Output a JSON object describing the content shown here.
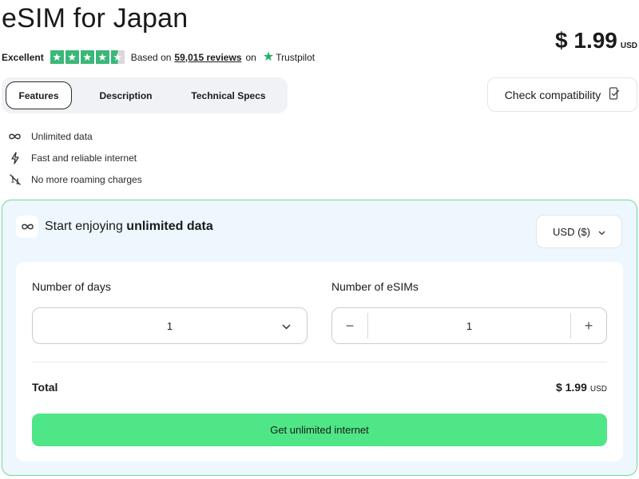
{
  "product": {
    "title": "eSIM for Japan",
    "price": "$ 1.99",
    "currency": "USD"
  },
  "rating": {
    "label": "Excellent",
    "stars": 4.5,
    "based_on": "Based on",
    "reviews": "59,015 reviews",
    "on": "on",
    "provider": "Trustpilot",
    "star_color": "#3bb779"
  },
  "tabs": [
    {
      "label": "Features",
      "active": true
    },
    {
      "label": "Description",
      "active": false
    },
    {
      "label": "Technical Specs",
      "active": false
    }
  ],
  "compatibility": {
    "label": "Check compatibility",
    "icon": "phone-check-icon"
  },
  "features": [
    {
      "icon": "infinity-icon",
      "label": "Unlimited data"
    },
    {
      "icon": "lightning-icon",
      "label": "Fast and reliable internet"
    },
    {
      "icon": "no-roaming-icon",
      "label": "No more roaming charges"
    }
  ],
  "panel": {
    "title_prefix": "Start enjoying",
    "title_bold": "unlimited data",
    "currency_select": "USD ($)",
    "days_label": "Number of days",
    "days_value": "1",
    "esims_label": "Number of eSIMs",
    "esims_value": "1",
    "minus": "−",
    "plus": "+",
    "total_label": "Total",
    "total_amount": "$ 1.99",
    "total_currency": "USD",
    "cta": "Get unlimited internet",
    "accent": "#4ee686",
    "panel_bg": "#edf7fd"
  }
}
